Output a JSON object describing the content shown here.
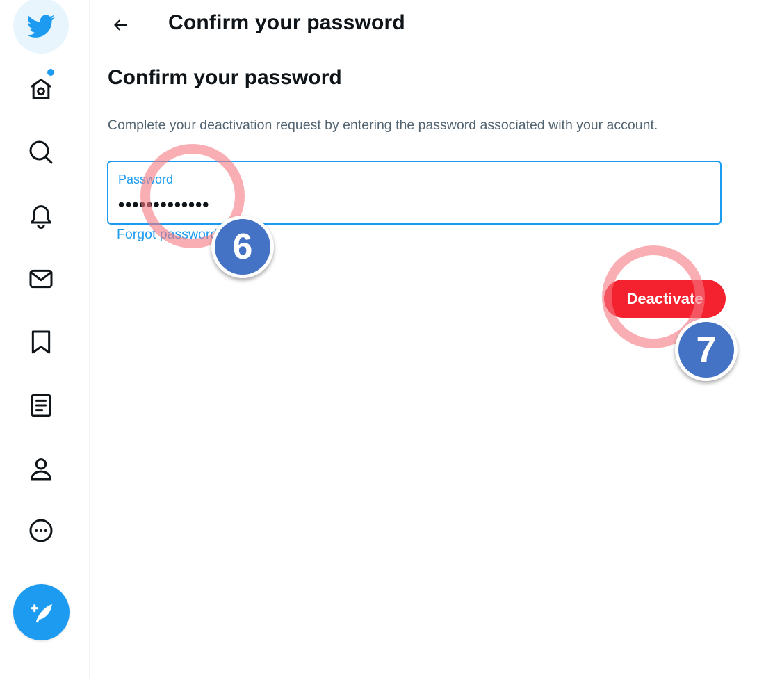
{
  "sidebar": {
    "items": [
      {
        "icon": "twitter-logo-icon"
      },
      {
        "icon": "home-icon"
      },
      {
        "icon": "search-icon"
      },
      {
        "icon": "bell-icon"
      },
      {
        "icon": "mail-icon"
      },
      {
        "icon": "bookmark-icon"
      },
      {
        "icon": "list-icon"
      },
      {
        "icon": "profile-icon"
      },
      {
        "icon": "more-icon"
      }
    ],
    "compose_icon": "compose-tweet-icon",
    "accent_color": "#1d9bf0"
  },
  "header": {
    "title": "Confirm your password"
  },
  "main": {
    "section_title": "Confirm your password",
    "description": "Complete your deactivation request by entering the password associated with your account.",
    "password": {
      "label": "Password",
      "value": "•••••••••••••"
    },
    "forgot_link": "Forgot password?",
    "deactivate_label": "Deactivate",
    "deactivate_color": "#f4212e"
  },
  "annotations": {
    "step_6": "6",
    "step_7": "7"
  }
}
